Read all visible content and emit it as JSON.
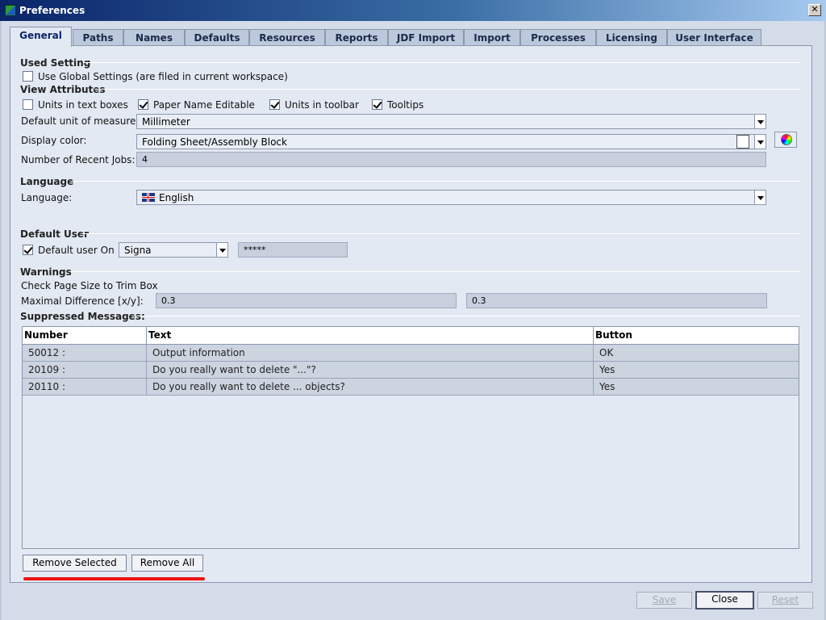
{
  "window": {
    "title": "Preferences",
    "close_glyph": "✕"
  },
  "tabs": [
    {
      "label": "General",
      "active": true
    },
    {
      "label": "Paths"
    },
    {
      "label": "Names"
    },
    {
      "label": "Defaults"
    },
    {
      "label": "Resources"
    },
    {
      "label": "Reports"
    },
    {
      "label": "JDF Import"
    },
    {
      "label": "Import"
    },
    {
      "label": "Processes"
    },
    {
      "label": "Licensing"
    },
    {
      "label": "User Interface"
    }
  ],
  "used_setting": {
    "heading": "Used Setting",
    "global_label": "Use Global Settings (are filed in current workspace)",
    "global_checked": false
  },
  "view_attributes": {
    "heading": "View Attributes",
    "units_textboxes": {
      "label": "Units in text boxes",
      "checked": false
    },
    "paper_name_editable": {
      "label": "Paper Name Editable",
      "checked": true
    },
    "units_toolbar": {
      "label": "Units in toolbar",
      "checked": true
    },
    "tooltips": {
      "label": "Tooltips",
      "checked": true
    },
    "unit_label": "Default unit of measure:",
    "unit_value": "Millimeter",
    "color_label": "Display color:",
    "color_value": "Folding Sheet/Assembly Block",
    "recent_label": "Number of Recent Jobs:",
    "recent_value": "4"
  },
  "language": {
    "heading": "Language",
    "label": "Language:",
    "value": "English"
  },
  "default_user": {
    "heading": "Default User",
    "on_label": "Default user On",
    "on_checked": true,
    "user_value": "Signa",
    "password_value": "*****"
  },
  "warnings": {
    "heading": "Warnings",
    "check_label": "Check Page Size to Trim Box",
    "diff_label": "Maximal Difference [x/y]:",
    "x_value": "0.3",
    "y_value": "0.3"
  },
  "suppressed": {
    "heading": "Suppressed Messages:",
    "columns": [
      "Number",
      "Text",
      "Button"
    ],
    "rows": [
      {
        "number": "50012 :",
        "text": "Output information",
        "button": "OK"
      },
      {
        "number": "20109 :",
        "text": "Do you really want to delete \"...\"?",
        "button": "Yes"
      },
      {
        "number": "20110 :",
        "text": "Do you really want to delete ... objects?",
        "button": "Yes"
      }
    ],
    "remove_selected": "Remove Selected",
    "remove_all": "Remove All"
  },
  "footer": {
    "save": "Save",
    "close": "Close",
    "reset": "Reset"
  },
  "colors": {
    "annotation_red": "#ee1111",
    "title_blue": "#0a246a"
  }
}
